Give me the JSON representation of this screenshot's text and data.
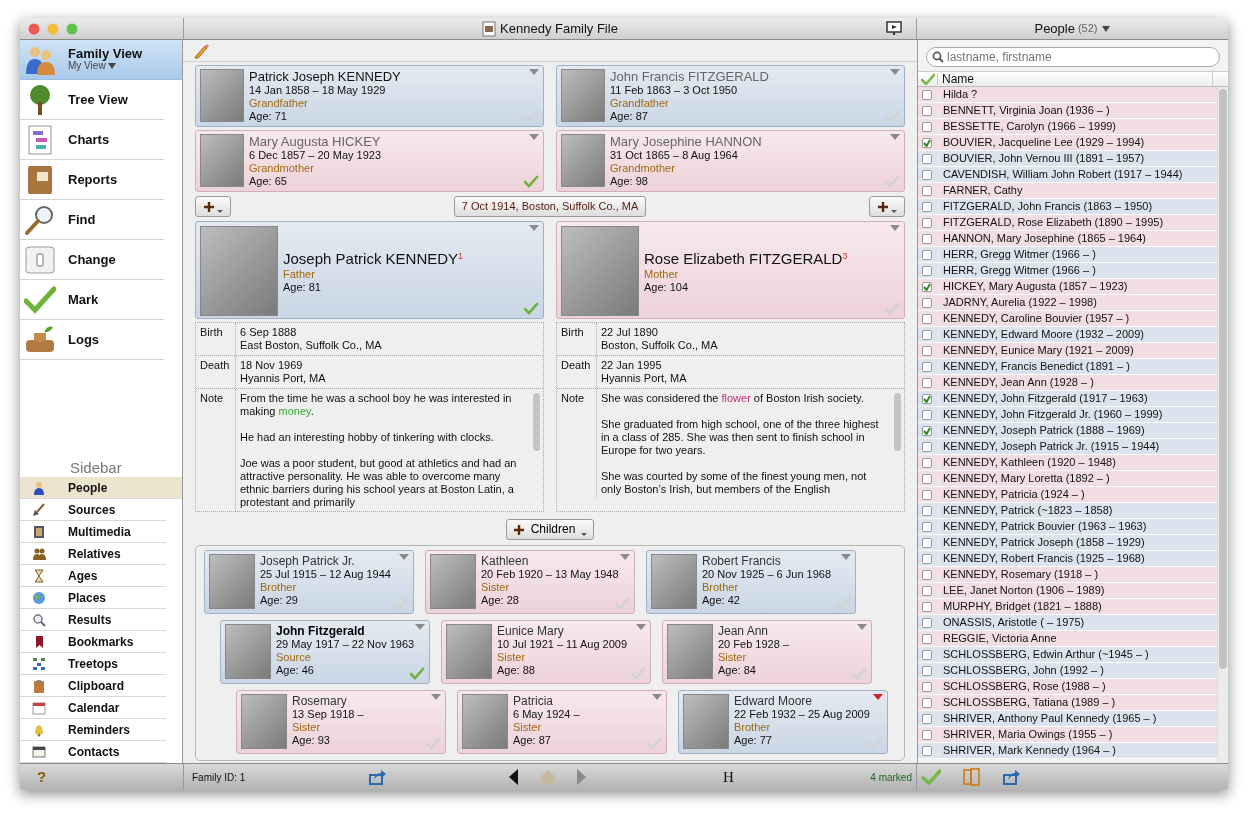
{
  "window": {
    "title": "Kennedy Family File"
  },
  "views": [
    {
      "label": "Family View",
      "sublabel": "My View",
      "selected": true
    },
    {
      "label": "Tree View",
      "selected": false
    },
    {
      "label": "Charts",
      "selected": false
    },
    {
      "label": "Reports",
      "selected": false
    },
    {
      "label": "Find",
      "selected": false
    },
    {
      "label": "Change",
      "selected": false
    },
    {
      "label": "Mark",
      "selected": false
    },
    {
      "label": "Logs",
      "selected": false
    }
  ],
  "sidebar": {
    "title": "Sidebar",
    "items": [
      {
        "label": "People",
        "selected": true
      },
      {
        "label": "Sources",
        "selected": false
      },
      {
        "label": "Multimedia",
        "selected": false
      },
      {
        "label": "Relatives",
        "selected": false
      },
      {
        "label": "Ages",
        "selected": false
      },
      {
        "label": "Places",
        "selected": false
      },
      {
        "label": "Results",
        "selected": false
      },
      {
        "label": "Bookmarks",
        "selected": false
      },
      {
        "label": "Treetops",
        "selected": false
      },
      {
        "label": "Clipboard",
        "selected": false
      },
      {
        "label": "Calendar",
        "selected": false
      },
      {
        "label": "Reminders",
        "selected": false
      },
      {
        "label": "Contacts",
        "selected": false
      }
    ]
  },
  "help": "?",
  "grandparents": [
    {
      "name": "Patrick Joseph KENNEDY",
      "dates": "14 Jan 1858 – 18 May 1929",
      "relation": "Grandfather",
      "age": "Age: 71",
      "kind": "male",
      "dimmed": false,
      "marked": false
    },
    {
      "name": "John Francis FITZGERALD",
      "dates": "11 Feb 1863 – 3 Oct 1950",
      "relation": "Grandfather",
      "age": "Age: 87",
      "kind": "male",
      "dimmed": true,
      "marked": false
    },
    {
      "name": "Mary Augusta HICKEY",
      "dates": "6 Dec 1857 – 20 May 1923",
      "relation": "Grandmother",
      "age": "Age: 65",
      "kind": "female",
      "dimmed": true,
      "marked": true
    },
    {
      "name": "Mary Josephine HANNON",
      "dates": "31 Oct 1865 – 8 Aug 1964",
      "relation": "Grandmother",
      "age": "Age: 98",
      "kind": "female",
      "dimmed": true,
      "marked": false
    }
  ],
  "marriage": "7 Oct 1914, Boston, Suffolk Co., MA",
  "parents": [
    {
      "name": "Joseph Patrick KENNEDY$^{1}$",
      "relation": "Father",
      "age": "Age: 81",
      "kind": "male",
      "marked": true,
      "facts": [
        {
          "label": "Birth",
          "date": "6 Sep 1888",
          "place": "East Boston, Suffolk Co., MA"
        },
        {
          "label": "Death",
          "date": "18 Nov 1969",
          "place": "Hyannis Port, MA"
        }
      ],
      "note": {
        "label": "Note",
        "paragraphs": [
          [
            {
              "text": "From the time he was a school boy he was interested in making "
            },
            {
              "text": "money",
              "color": "#3aa832"
            },
            {
              "text": "."
            }
          ],
          [
            {
              "text": "He had an interesting hobby of tinkering with clocks."
            }
          ],
          [
            {
              "text": "Joe was a poor student, but good at athletics and had an attractive personality. He was able to overcome many ethnic barriers during his school years at Boston Latin, a protestant and primarily"
            }
          ]
        ]
      }
    },
    {
      "name": "Rose Elizabeth FITZGERALD$^{3}$",
      "relation": "Mother",
      "age": "Age: 104",
      "kind": "female",
      "marked": false,
      "facts": [
        {
          "label": "Birth",
          "date": "22 Jul 1890",
          "place": "Boston, Suffolk Co., MA"
        },
        {
          "label": "Death",
          "date": "22 Jan 1995",
          "place": "Hyannis Port, MA"
        }
      ],
      "note": {
        "label": "Note",
        "paragraphs": [
          [
            {
              "text": "She was considered the "
            },
            {
              "text": "flower",
              "color": "#c0307a"
            },
            {
              "text": " of Boston Irish society."
            }
          ],
          [
            {
              "text": "She graduated from high school, one of the three highest in a class of 285. She was then sent to finish school in Europe for two years."
            }
          ],
          [
            {
              "text": "She was courted by some of the finest young men, not only Boston’s Irish, but members of the English"
            }
          ]
        ]
      }
    }
  ],
  "children_button": "Children",
  "children": [
    [
      {
        "name": "Joseph Patrick Jr.",
        "dates": "25 Jul 1915 – 12 Aug 1944",
        "relation": "Brother",
        "age": "Age: 29",
        "kind": "male",
        "selected": false,
        "flagged": false,
        "marked": false
      },
      {
        "name": "Kathleen",
        "dates": "20 Feb 1920 – 13 May 1948",
        "relation": "Sister",
        "age": "Age: 28",
        "kind": "female",
        "selected": false,
        "flagged": false,
        "marked": false
      },
      {
        "name": "Robert Francis",
        "dates": "20 Nov 1925 – 6 Jun 1968",
        "relation": "Brother",
        "age": "Age: 42",
        "kind": "male",
        "selected": false,
        "flagged": false,
        "marked": false
      }
    ],
    [
      {
        "name": "John Fitzgerald",
        "dates": "29 May 1917 – 22 Nov 1963",
        "relation": "Source",
        "age": "Age: 46",
        "kind": "male",
        "selected": true,
        "flagged": false,
        "marked": true
      },
      {
        "name": "Eunice Mary",
        "dates": "10 Jul 1921 – 11 Aug 2009",
        "relation": "Sister",
        "age": "Age: 88",
        "kind": "female",
        "selected": false,
        "flagged": false,
        "marked": false
      },
      {
        "name": "Jean Ann",
        "dates": "20 Feb 1928 –",
        "relation": "Sister",
        "age": "Age: 84",
        "kind": "female",
        "selected": false,
        "flagged": false,
        "marked": false
      }
    ],
    [
      {
        "name": "Rosemary",
        "dates": "13 Sep 1918 –",
        "relation": "Sister",
        "age": "Age: 93",
        "kind": "female",
        "selected": false,
        "flagged": false,
        "marked": false
      },
      {
        "name": "Patricia",
        "dates": "6 May 1924 –",
        "relation": "Sister",
        "age": "Age: 87",
        "kind": "female",
        "selected": false,
        "flagged": false,
        "marked": false
      },
      {
        "name": "Edward Moore",
        "dates": "22 Feb 1932 – 25 Aug 2009",
        "relation": "Brother",
        "age": "Age: 77",
        "kind": "male",
        "selected": false,
        "flagged": true,
        "marked": false
      }
    ]
  ],
  "status": {
    "family_id": "Family ID: 1",
    "history": "H",
    "marked": "4 marked"
  },
  "people": {
    "title": "People",
    "count": "(52)",
    "search": {
      "placeholder": "lastname, firstname"
    },
    "column": "Name",
    "rows": [
      {
        "name": "Hilda ?",
        "kind": "female",
        "checked": false
      },
      {
        "name": "BENNETT, Virginia Joan (1936 – )",
        "kind": "female",
        "checked": false
      },
      {
        "name": "BESSETTE, Carolyn (1966 – 1999)",
        "kind": "female",
        "checked": false
      },
      {
        "name": "BOUVIER, Jacqueline Lee (1929 – 1994)",
        "kind": "female",
        "checked": true
      },
      {
        "name": "BOUVIER, John Vernou III (1891 – 1957)",
        "kind": "male",
        "checked": false
      },
      {
        "name": "CAVENDISH, William John Robert (1917 – 1944)",
        "kind": "male",
        "checked": false
      },
      {
        "name": "FARNER, Cathy",
        "kind": "female",
        "checked": false
      },
      {
        "name": "FITZGERALD, John Francis (1863 – 1950)",
        "kind": "male",
        "checked": false
      },
      {
        "name": "FITZGERALD, Rose Elizabeth (1890 – 1995)",
        "kind": "female",
        "checked": false
      },
      {
        "name": "HANNON, Mary Josephine (1865 – 1964)",
        "kind": "female",
        "checked": false
      },
      {
        "name": "HERR, Gregg Witmer (1966 – )",
        "kind": "male",
        "checked": false
      },
      {
        "name": "HERR, Gregg Witmer (1966 – )",
        "kind": "male",
        "checked": false
      },
      {
        "name": "HICKEY, Mary Augusta (1857 – 1923)",
        "kind": "female",
        "checked": true
      },
      {
        "name": "JADRNY, Aurelia (1922 – 1998)",
        "kind": "female",
        "checked": false
      },
      {
        "name": "KENNEDY, Caroline Bouvier (1957 – )",
        "kind": "female",
        "checked": false
      },
      {
        "name": "KENNEDY, Edward Moore (1932 – 2009)",
        "kind": "male",
        "checked": false
      },
      {
        "name": "KENNEDY, Eunice Mary (1921 – 2009)",
        "kind": "female",
        "checked": false
      },
      {
        "name": "KENNEDY, Francis Benedict (1891 – )",
        "kind": "male",
        "checked": false
      },
      {
        "name": "KENNEDY, Jean Ann (1928 – )",
        "kind": "female",
        "checked": false
      },
      {
        "name": "KENNEDY, John Fitzgerald (1917 – 1963)",
        "kind": "male",
        "checked": true
      },
      {
        "name": "KENNEDY, John Fitzgerald Jr. (1960 – 1999)",
        "kind": "male",
        "checked": false
      },
      {
        "name": "KENNEDY, Joseph Patrick (1888 – 1969)",
        "kind": "male",
        "checked": true
      },
      {
        "name": "KENNEDY, Joseph Patrick Jr. (1915 – 1944)",
        "kind": "male",
        "checked": false
      },
      {
        "name": "KENNEDY, Kathleen (1920 – 1948)",
        "kind": "female",
        "checked": false
      },
      {
        "name": "KENNEDY, Mary Loretta (1892 – )",
        "kind": "female",
        "checked": false
      },
      {
        "name": "KENNEDY, Patricia (1924 – )",
        "kind": "female",
        "checked": false
      },
      {
        "name": "KENNEDY, Patrick (~1823 – 1858)",
        "kind": "male",
        "checked": false
      },
      {
        "name": "KENNEDY, Patrick Bouvier (1963 – 1963)",
        "kind": "male",
        "checked": false
      },
      {
        "name": "KENNEDY, Patrick Joseph (1858 – 1929)",
        "kind": "male",
        "checked": false
      },
      {
        "name": "KENNEDY, Robert Francis (1925 – 1968)",
        "kind": "male",
        "checked": false
      },
      {
        "name": "KENNEDY, Rosemary (1918 – )",
        "kind": "female",
        "checked": false
      },
      {
        "name": "LEE, Janet Norton (1906 – 1989)",
        "kind": "female",
        "checked": false
      },
      {
        "name": "MURPHY, Bridget (1821 – 1888)",
        "kind": "female",
        "checked": false
      },
      {
        "name": "ONASSIS, Aristotle ( – 1975)",
        "kind": "male",
        "checked": false
      },
      {
        "name": "REGGIE, Victoria Anne",
        "kind": "female",
        "checked": false
      },
      {
        "name": "SCHLOSSBERG, Edwin Arthur (~1945 – )",
        "kind": "male",
        "checked": false
      },
      {
        "name": "SCHLOSSBERG, John (1992 – )",
        "kind": "male",
        "checked": false
      },
      {
        "name": "SCHLOSSBERG, Rose (1988 – )",
        "kind": "female",
        "checked": false
      },
      {
        "name": "SCHLOSSBERG, Tatiana (1989 – )",
        "kind": "female",
        "checked": false
      },
      {
        "name": "SHRIVER, Anthony Paul Kennedy (1965 – )",
        "kind": "male",
        "checked": false
      },
      {
        "name": "SHRIVER, Maria Owings (1955 – )",
        "kind": "female",
        "checked": false
      },
      {
        "name": "SHRIVER, Mark Kennedy (1964 – )",
        "kind": "male",
        "checked": false
      }
    ]
  }
}
